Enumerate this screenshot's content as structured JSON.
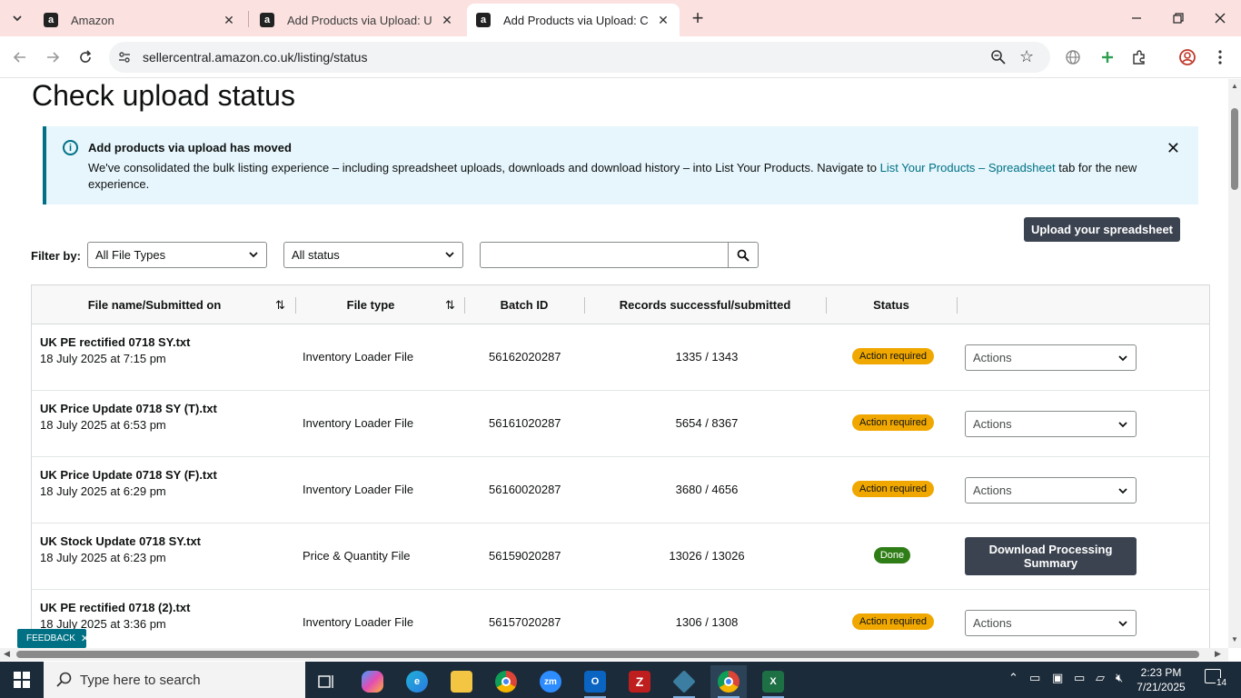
{
  "browser": {
    "tabs": [
      {
        "title": "Amazon",
        "active": false
      },
      {
        "title": "Add Products via Upload: Uplo",
        "active": false
      },
      {
        "title": "Add Products via Upload: Chec",
        "active": true
      }
    ],
    "url": "sellercentral.amazon.co.uk/listing/status"
  },
  "page": {
    "title": "Check upload status",
    "alert": {
      "title": "Add products via upload has moved",
      "body_before": "We've consolidated the bulk listing experience – including spreadsheet uploads, downloads and download history – into List Your Products. Navigate to ",
      "link": "List Your Products – Spreadsheet",
      "body_after": " tab for the new experience."
    },
    "upload_button": "Upload your spreadsheet",
    "filter_label": "Filter by:",
    "file_type_select": "All File Types",
    "status_select": "All status",
    "search_value": "",
    "columns": [
      "File name/Submitted on",
      "File type",
      "Batch ID",
      "Records successful/submitted",
      "Status"
    ],
    "rows": [
      {
        "name": "UK PE rectified 0718 SY.txt",
        "date": "18 July 2025 at 7:15 pm",
        "type": "Inventory Loader File",
        "batch": "56162020287",
        "records": "1335 / 1343",
        "status": "Action required",
        "action": "Actions"
      },
      {
        "name": "UK Price Update 0718 SY (T).txt",
        "date": "18 July 2025 at 6:53 pm",
        "type": "Inventory Loader File",
        "batch": "56161020287",
        "records": "5654 / 8367",
        "status": "Action required",
        "action": "Actions"
      },
      {
        "name": "UK Price Update 0718 SY (F).txt",
        "date": "18 July 2025 at 6:29 pm",
        "type": "Inventory Loader File",
        "batch": "56160020287",
        "records": "3680 / 4656",
        "status": "Action required",
        "action": "Actions"
      },
      {
        "name": "UK Stock Update 0718 SY.txt",
        "date": "18 July 2025 at 6:23 pm",
        "type": "Price & Quantity File",
        "batch": "56159020287",
        "records": "13026 / 13026",
        "status": "Done",
        "action": "Download Processing Summary"
      },
      {
        "name": "UK PE rectified 0718 (2).txt",
        "date": "18 July 2025 at 3:36 pm",
        "type": "Inventory Loader File",
        "batch": "56157020287",
        "records": "1306 / 1308",
        "status": "Action required",
        "action": "Actions"
      }
    ],
    "feedback": "FEEDBACK"
  },
  "taskbar": {
    "search_placeholder": "Type here to search",
    "time": "2:23 PM",
    "date": "7/21/2025",
    "notifications": "14"
  },
  "colors": {
    "accent": "#007185",
    "warning_badge": "#f0a800",
    "done_badge": "#2f7d16",
    "dark_button": "#3b4350",
    "tab_strip": "#fbe2e0"
  }
}
